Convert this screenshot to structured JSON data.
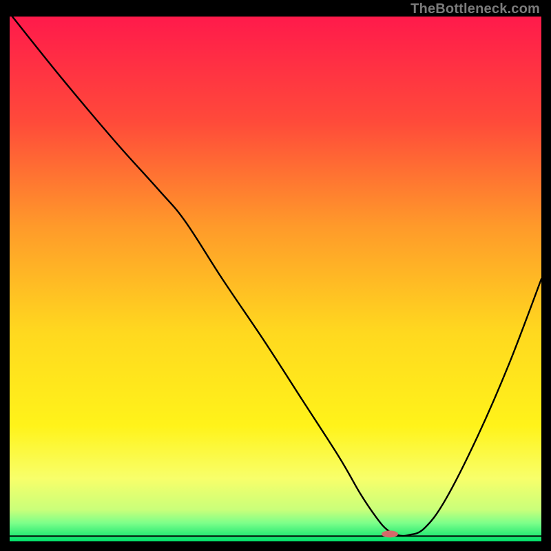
{
  "watermark": "TheBottleneck.com",
  "chart_data": {
    "type": "line",
    "title": "",
    "xlabel": "",
    "ylabel": "",
    "xlim": [
      0,
      100
    ],
    "ylim": [
      0,
      100
    ],
    "gradient_stops": [
      {
        "offset": 0.0,
        "color": "#ff1a4b"
      },
      {
        "offset": 0.2,
        "color": "#ff4a3a"
      },
      {
        "offset": 0.4,
        "color": "#ff9a2a"
      },
      {
        "offset": 0.6,
        "color": "#ffd81f"
      },
      {
        "offset": 0.78,
        "color": "#fff31a"
      },
      {
        "offset": 0.88,
        "color": "#f8ff6a"
      },
      {
        "offset": 0.94,
        "color": "#c9ff7a"
      },
      {
        "offset": 0.965,
        "color": "#7dff8a"
      },
      {
        "offset": 1.0,
        "color": "#00e06a"
      }
    ],
    "series": [
      {
        "name": "bottleneck-curve",
        "x": [
          0.5,
          10,
          20,
          28,
          33,
          40,
          48,
          55,
          62,
          66,
          69,
          71,
          73,
          75,
          78,
          82,
          88,
          94,
          100
        ],
        "y": [
          100,
          88,
          76,
          67,
          61,
          50,
          38,
          27,
          16,
          9,
          4.5,
          2.2,
          1.2,
          1.2,
          2.5,
          8,
          20,
          34,
          50
        ]
      }
    ],
    "marker": {
      "x": 71.5,
      "y": 1.4,
      "color": "#d46a6a",
      "rx": 12,
      "ry": 5
    },
    "baseline_y": 1.0
  }
}
